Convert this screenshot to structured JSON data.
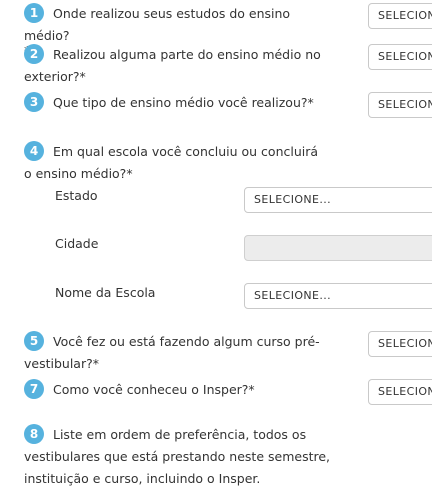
{
  "questions": [
    {
      "num": "1",
      "text": "Onde realizou seus estudos do ensino médio?",
      "required_mark": "*",
      "select": "SELECIONE..."
    },
    {
      "num": "2",
      "text": "Realizou alguma parte do ensino médio no exterior?*",
      "select": "SELECIONE..."
    },
    {
      "num": "3",
      "text": "Que tipo de ensino médio você realizou?*",
      "select": "SELECIONE..."
    },
    {
      "num": "4",
      "text": "Em qual escola você concluiu ou concluirá o ensino médio?*"
    },
    {
      "num": "5",
      "text": "Você fez ou está fazendo algum curso pré-vestibular?*",
      "select": "SELECIONE..."
    },
    {
      "num": "7",
      "text": "Como você conheceu o Insper?*",
      "select": "SELECIONE..."
    },
    {
      "num": "8",
      "text": "Liste em ordem de preferência, todos os vestibulares que está prestando neste semestre, instituição e curso, incluindo o Insper."
    }
  ],
  "school": {
    "estado_label": "Estado",
    "estado_value": "SELECIONE...",
    "cidade_label": "Cidade",
    "cidade_value": "",
    "escola_label": "Nome da Escola",
    "escola_value": "SELECIONE..."
  },
  "colors": {
    "badge": "#56b2de",
    "text": "#333333",
    "border": "#c9c9c9",
    "disabled": "#ececec"
  }
}
